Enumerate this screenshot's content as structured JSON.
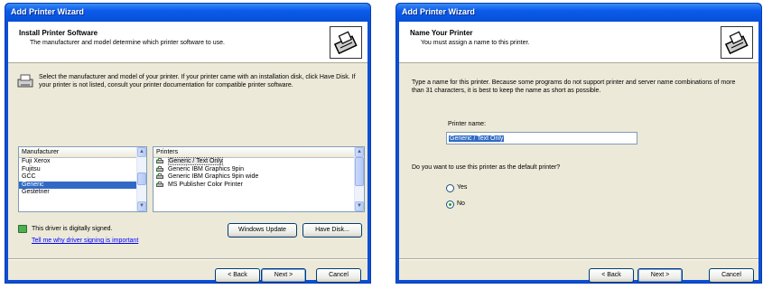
{
  "left": {
    "title": "Add Printer Wizard",
    "header_title": "Install Printer Software",
    "header_sub": "The manufacturer and model determine which printer software to use.",
    "intro": "Select the manufacturer and model of your printer. If your printer came with an installation disk, click Have Disk. If your printer is not listed, consult your printer documentation for compatible printer software.",
    "manufacturer_header": "Manufacturer",
    "manufacturers": [
      "Fuji Xerox",
      "Fujitsu",
      "GCC",
      "Generic",
      "Gestetner"
    ],
    "selected_manufacturer": "Generic",
    "printers_header": "Printers",
    "printers": [
      "Generic / Text Only",
      "Generic IBM Graphics 9pin",
      "Generic IBM Graphics 9pin wide",
      "MS Publisher Color Printer"
    ],
    "selected_printer": "Generic / Text Only",
    "signed_text": "This driver is digitally signed.",
    "signing_link": "Tell me why driver signing is important",
    "windows_update": "Windows Update",
    "have_disk": "Have Disk...",
    "back": "< Back",
    "next": "Next >",
    "cancel": "Cancel"
  },
  "right": {
    "title": "Add Printer Wizard",
    "header_title": "Name Your Printer",
    "header_sub": "You must assign a name to this printer.",
    "intro": "Type a name for this printer. Because some programs do not support printer and server name combinations of more than 31 characters, it is best to keep the name as short as possible.",
    "printer_name_label": "Printer name:",
    "printer_name_value": "Generic / Text Only",
    "default_question": "Do you want to use this printer as the default printer?",
    "yes": "Yes",
    "no": "No",
    "default_choice": "no",
    "back": "< Back",
    "next": "Next >",
    "cancel": "Cancel"
  }
}
